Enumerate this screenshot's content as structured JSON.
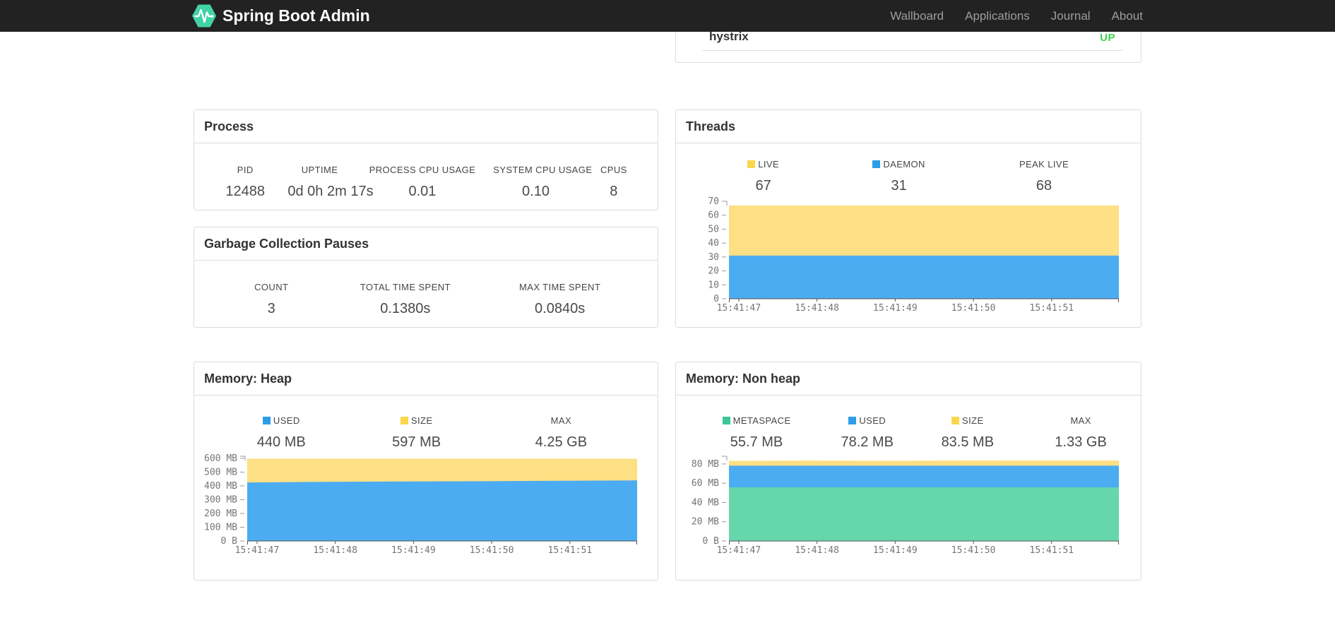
{
  "navbar": {
    "brand": "Spring Boot Admin",
    "brand_icon": "pulse-hexagon-icon",
    "brand_icon_color": "#42d3a5",
    "background": "#222222",
    "items": [
      "Wallboard",
      "Applications",
      "Journal",
      "About"
    ]
  },
  "application_panel": {
    "row": {
      "name": "hystrix",
      "status": "UP",
      "status_color": "#3ed34f"
    }
  },
  "panels": {
    "process": {
      "title": "Process",
      "stats": [
        {
          "label": "PID",
          "value": "12488"
        },
        {
          "label": "UPTIME",
          "value": "0d 0h 2m 17s"
        },
        {
          "label": "PROCESS CPU USAGE",
          "value": "0.01"
        },
        {
          "label": "SYSTEM CPU USAGE",
          "value": "0.10"
        },
        {
          "label": "CPUS",
          "value": "8"
        }
      ]
    },
    "gc": {
      "title": "Garbage Collection Pauses",
      "stats": [
        {
          "label": "COUNT",
          "value": "3"
        },
        {
          "label": "TOTAL TIME SPENT",
          "value": "0.1380s"
        },
        {
          "label": "MAX TIME SPENT",
          "value": "0.0840s"
        }
      ]
    },
    "threads": {
      "title": "Threads",
      "stats": [
        {
          "label": "LIVE",
          "value": "67",
          "swatch": "#fbd64a"
        },
        {
          "label": "DAEMON",
          "value": "31",
          "swatch": "#2d9de9"
        },
        {
          "label": "PEAK LIVE",
          "value": "68"
        }
      ],
      "chart": {
        "type": "area",
        "x_labels": [
          "15:41:47",
          "15:41:48",
          "15:41:49",
          "15:41:50",
          "15:41:51"
        ],
        "y_ticks": [
          {
            "v": 0,
            "label": "0"
          },
          {
            "v": 10,
            "label": "10"
          },
          {
            "v": 20,
            "label": "20"
          },
          {
            "v": 30,
            "label": "30"
          },
          {
            "v": 40,
            "label": "40"
          },
          {
            "v": 50,
            "label": "50"
          },
          {
            "v": 60,
            "label": "60"
          },
          {
            "v": 70,
            "label": "70"
          }
        ],
        "axis_max": 70,
        "series": [
          {
            "name": "LIVE",
            "fill": "#fde084",
            "values": [
              67,
              67,
              67,
              67,
              67,
              67
            ]
          },
          {
            "name": "DAEMON",
            "fill": "#4bacf1",
            "values": [
              31,
              31,
              31,
              31,
              31,
              31
            ]
          }
        ]
      }
    },
    "heap": {
      "title": "Memory: Heap",
      "stats": [
        {
          "label": "USED",
          "value": "440 MB",
          "swatch": "#2d9de9"
        },
        {
          "label": "SIZE",
          "value": "597 MB",
          "swatch": "#fbd64a"
        },
        {
          "label": "MAX",
          "value": "4.25 GB"
        }
      ],
      "chart": {
        "type": "area",
        "x_labels": [
          "15:41:47",
          "15:41:48",
          "15:41:49",
          "15:41:50",
          "15:41:51"
        ],
        "y_ticks": [
          {
            "v": 0,
            "label": "0 B"
          },
          {
            "v": 100,
            "label": "100 MB"
          },
          {
            "v": 200,
            "label": "200 MB"
          },
          {
            "v": 300,
            "label": "300 MB"
          },
          {
            "v": 400,
            "label": "400 MB"
          },
          {
            "v": 500,
            "label": "500 MB"
          },
          {
            "v": 600,
            "label": "600 MB"
          }
        ],
        "axis_max": 615,
        "series": [
          {
            "name": "SIZE",
            "fill": "#fde084",
            "values": [
              597,
              597,
              597,
              597,
              597,
              597
            ]
          },
          {
            "name": "USED",
            "fill": "#4bacf1",
            "values": [
              425,
              429,
              432,
              434,
              437,
              440
            ]
          }
        ]
      }
    },
    "nonheap": {
      "title": "Memory: Non heap",
      "stats": [
        {
          "label": "METASPACE",
          "value": "55.7 MB",
          "swatch": "#3cc69a"
        },
        {
          "label": "USED",
          "value": "78.2 MB",
          "swatch": "#2d9de9"
        },
        {
          "label": "SIZE",
          "value": "83.5 MB",
          "swatch": "#fbd64a"
        },
        {
          "label": "MAX",
          "value": "1.33 GB"
        }
      ],
      "chart": {
        "type": "area",
        "x_labels": [
          "15:41:47",
          "15:41:48",
          "15:41:49",
          "15:41:50",
          "15:41:51"
        ],
        "y_ticks": [
          {
            "v": 0,
            "label": "0 B"
          },
          {
            "v": 20,
            "label": "20 MB"
          },
          {
            "v": 40,
            "label": "40 MB"
          },
          {
            "v": 60,
            "label": "60 MB"
          },
          {
            "v": 80,
            "label": "80 MB"
          }
        ],
        "axis_max": 88,
        "series": [
          {
            "name": "SIZE",
            "fill": "#fde084",
            "values": [
              83.2,
              83.5,
              83.3,
              83.6,
              83.5,
              83.5
            ]
          },
          {
            "name": "USED",
            "fill": "#4bacf1",
            "values": [
              78.2,
              78.2,
              78.2,
              78.2,
              78.2,
              78.2
            ]
          },
          {
            "name": "METASPACE",
            "fill": "#66d7ad",
            "values": [
              55.7,
              55.7,
              55.7,
              55.7,
              55.7,
              55.7
            ]
          }
        ]
      }
    }
  }
}
